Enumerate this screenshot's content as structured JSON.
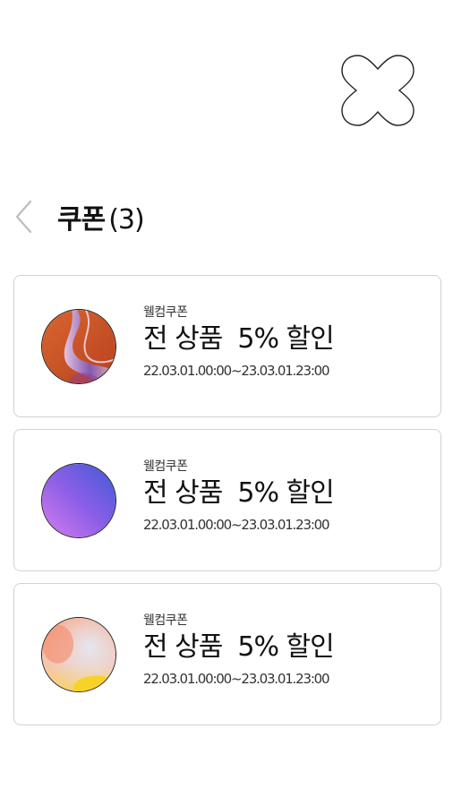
{
  "header": {
    "close_icon": "close-x-icon",
    "back_icon": "chevron-left-icon",
    "title": "쿠폰",
    "count": "(3)"
  },
  "coupons": [
    {
      "type": "웰컴쿠폰",
      "title": "전 상품  5% 할인",
      "period": "22.03.01.00:00~23.03.01.23:00",
      "thumb": "orange-abstract-image"
    },
    {
      "type": "웰컴쿠폰",
      "title": "전 상품  5% 할인",
      "period": "22.03.01.00:00~23.03.01.23:00",
      "thumb": "purple-gradient-image"
    },
    {
      "type": "웰컴쿠폰",
      "title": "전 상품  5% 할인",
      "period": "22.03.01.00:00~23.03.01.23:00",
      "thumb": "pastel-gradient-image"
    }
  ],
  "colors": {
    "card_border": "#d2d2d2",
    "text": "#111111"
  }
}
